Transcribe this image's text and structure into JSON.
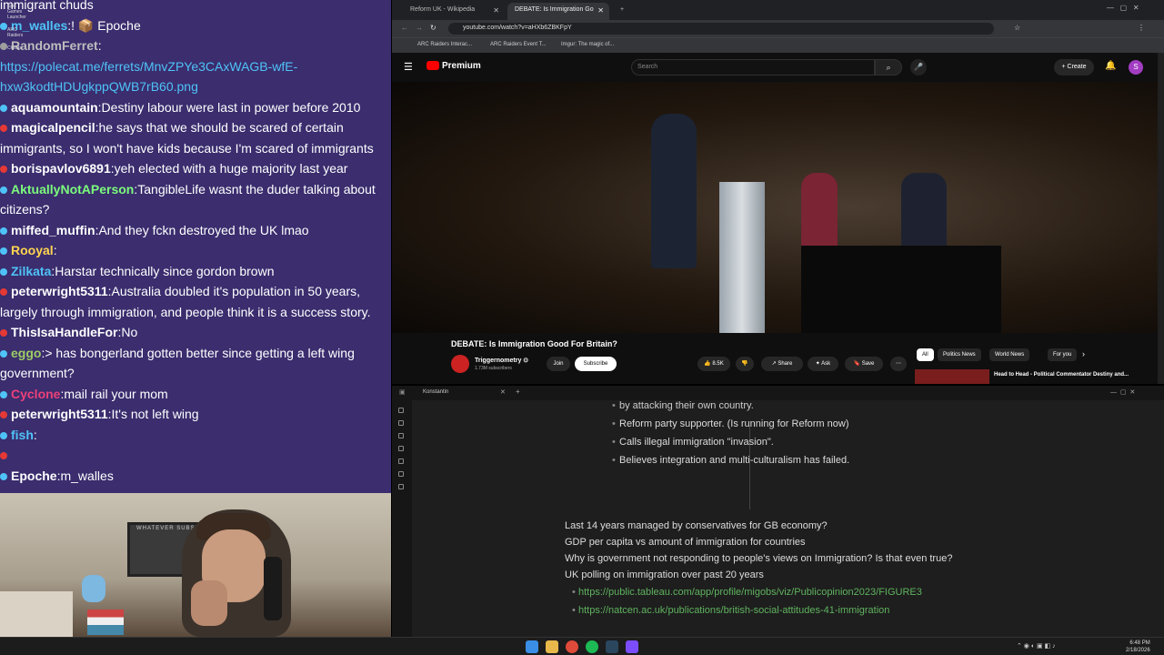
{
  "chat": {
    "messages": [
      {
        "user": "",
        "text": "immigrant chuds",
        "color": "#ffffff",
        "dot": ""
      },
      {
        "user": "m_walles",
        "text": ":! 📦 Epoche",
        "color": "#4fc3f7",
        "dot": "#4fc3f7"
      },
      {
        "user": "RandomFerret",
        "text": ":",
        "color": "#bdbdbd",
        "dot": "#9e9e9e"
      },
      {
        "user": "",
        "text": "https://polecat.me/ferrets/MnvZPYe3CAxWAGB-wfE-hxw3kodtHDUgkppQWB7rB60.png",
        "color": "#4fc3f7",
        "dot": ""
      },
      {
        "user": "aquamountain",
        "text": ":Destiny labour were last in power before 2010",
        "color": "#ffffff",
        "dot": "#4fc3f7"
      },
      {
        "user": "magicalpencil",
        "text": ":he says that we should be scared of certain immigrants, so I won't have kids because I'm scared of immigrants",
        "color": "#ffffff",
        "dot": "#e53935"
      },
      {
        "user": "borispavlov6891",
        "text": ":yeh elected with a huge majority last year",
        "color": "#ffffff",
        "dot": "#e53935"
      },
      {
        "user": "AktuallyNotAPerson",
        "text": ":TangibleLife wasnt the duder talking about citizens?",
        "color": "#7CFC7C",
        "dot": "#4fc3f7"
      },
      {
        "user": "miffed_muffin",
        "text": ":And they fckn destroyed the UK lmao",
        "color": "#ffffff",
        "dot": "#4fc3f7"
      },
      {
        "user": "Rooyal",
        "text": ":",
        "color": "#ffd54f",
        "dot": "#4fc3f7"
      },
      {
        "user": "Zilkata",
        "text": ":Harstar technically since gordon brown",
        "color": "#4fc3f7",
        "dot": "#4fc3f7"
      },
      {
        "user": "peterwright5311",
        "text": ":Australia doubled it's population in 50 years, largely through immigration, and people think it is a success story.",
        "color": "#ffffff",
        "dot": "#e53935"
      },
      {
        "user": "ThisIsaHandleFor",
        "text": ":No",
        "color": "#ffffff",
        "dot": "#e53935"
      },
      {
        "user": "eggo",
        "text": ":> has bongerland gotten better since getting a left wing government?",
        "color": "#9ccc65",
        "dot": "#4fc3f7"
      },
      {
        "user": "Cyclone",
        "text": ":mail rail your mom",
        "color": "#ec407a",
        "dot": "#4fc3f7"
      },
      {
        "user": "peterwright5311",
        "text": ":It's not left wing",
        "color": "#ffffff",
        "dot": "#e53935"
      },
      {
        "user": "fish",
        "text": ":",
        "color": "#4fc3f7",
        "dot": "#4fc3f7"
      },
      {
        "user": "",
        "text": "",
        "color": "#ffffff",
        "dot": "#e53935"
      },
      {
        "user": "Epoche",
        "text": ":m_walles",
        "color": "#ffffff",
        "dot": "#4fc3f7"
      }
    ],
    "desktop_icons": [
      "Epic Games Launcher",
      "ARC Raiders",
      "Cheats"
    ]
  },
  "webcam": {
    "board_text": "WHATEVER SUBSCRIBE"
  },
  "browser": {
    "tabs": [
      {
        "label": "Reform UK - Wikipedia",
        "active": false
      },
      {
        "label": "DEBATE: Is Immigration Go",
        "active": true
      }
    ],
    "url": "youtube.com/watch?v=aHXb6ZBKFpY",
    "bookmarks": [
      "ARC Raiders Interac...",
      "ARC Raiders Event T...",
      "Imgur: The magic of..."
    ]
  },
  "youtube": {
    "logo": "Premium",
    "search_placeholder": "Search",
    "create_label": "Create",
    "avatar_letter": "S",
    "video_title": "DEBATE: Is Immigration Good For Britain?",
    "channel_name": "Triggernometry ⊙",
    "subscribers": "1.73M subscribers",
    "join_label": "Join",
    "subscribe_label": "Subscribe",
    "likes": "8.5K",
    "share_label": "Share",
    "ask_label": "Ask",
    "save_label": "Save",
    "chips": [
      "All",
      "Politics News",
      "World News",
      "For you"
    ],
    "rec_title": "Head to Head - Political Commentator Destiny and..."
  },
  "notes": {
    "tab_name": "Konstantin",
    "partial_bullet": "by attacking their own country.",
    "bullets": [
      "Reform party supporter. (Is running for Reform now)",
      "Calls illegal immigration \"invasion\".",
      "Believes integration and multi-culturalism has failed."
    ],
    "lines": [
      "Last 14 years managed by conservatives for GB economy?",
      "GDP per capita vs amount of immigration for countries",
      "Why is government not responding to people's views on Immigration? Is that even true?",
      "UK polling on immigration over past 20 years"
    ],
    "links": [
      "https://public.tableau.com/app/profile/migobs/viz/Publicopinion2023/FIGURE3",
      "https://natcen.ac.uk/publications/british-social-attitudes-41-immigration"
    ]
  },
  "taskbar": {
    "time": "6:48 PM",
    "date": "2/18/2026"
  }
}
